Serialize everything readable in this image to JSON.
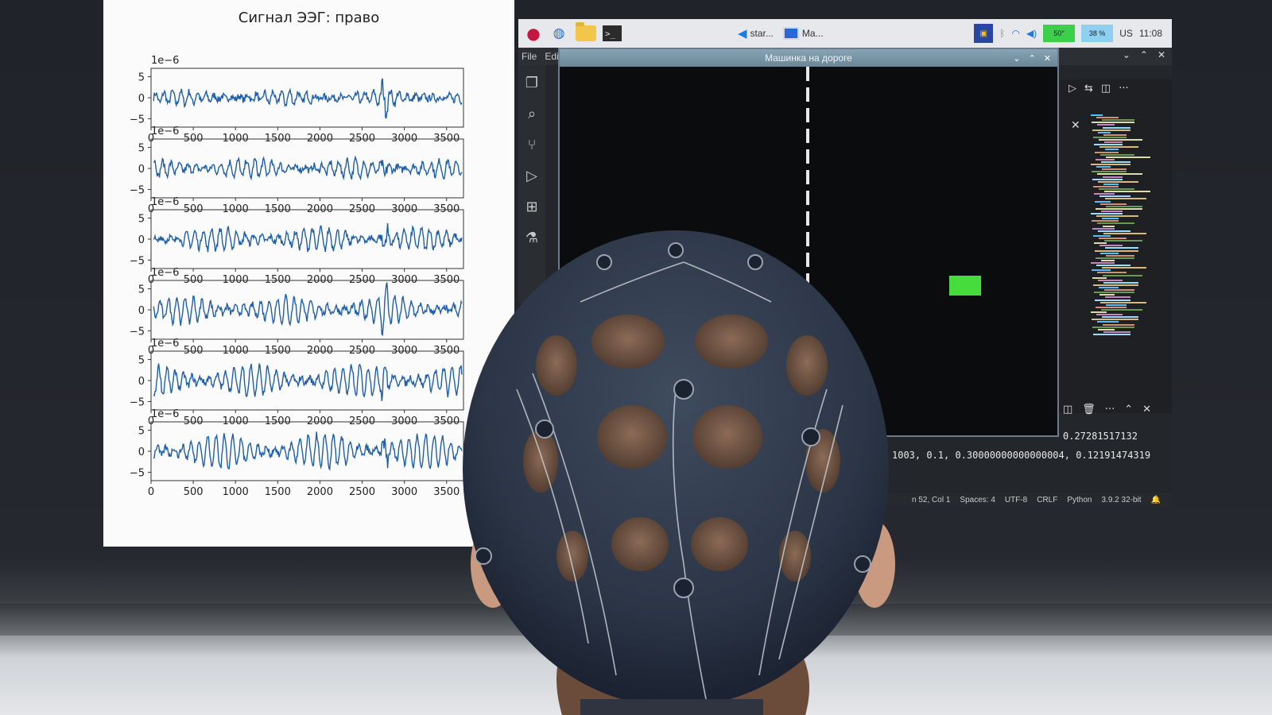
{
  "plot_window": {
    "title": "Сигнал ЭЭГ: право",
    "scale_label": "1e−6",
    "y_ticks": [
      "5",
      "0",
      "−5"
    ],
    "x_ticks": [
      "0",
      "500",
      "1000",
      "1500",
      "2000",
      "2500",
      "3000",
      "3500"
    ]
  },
  "chart_data": {
    "type": "line",
    "title": "Сигнал ЭЭГ: право",
    "subplots": 6,
    "xlim": [
      0,
      3700
    ],
    "ylim": [
      -7,
      7
    ],
    "y_scale_factor": "1e−6",
    "series_color": "#1f5fa8"
  },
  "taskbar": {
    "task_vscode": "star...",
    "task_window": "Ma...",
    "meter_cpu": "50°",
    "meter_mem": "38 %",
    "keyboard": "US",
    "clock": "11:08"
  },
  "vscode": {
    "menu_file": "File",
    "menu_edit": "Edit",
    "term_line1": "0.27281517132",
    "term_line2": "1003, 0.1, 0.30000000000000004, 0.12191474319",
    "status_pos": "n 52, Col 1",
    "status_spaces": "Spaces: 4",
    "status_enc": "UTF-8",
    "status_eol": "CRLF",
    "status_lang": "Python",
    "status_ver": "3.9.2 32-bit"
  },
  "game": {
    "title": "Машинка на дороге",
    "car_color": "#46dc3b"
  }
}
